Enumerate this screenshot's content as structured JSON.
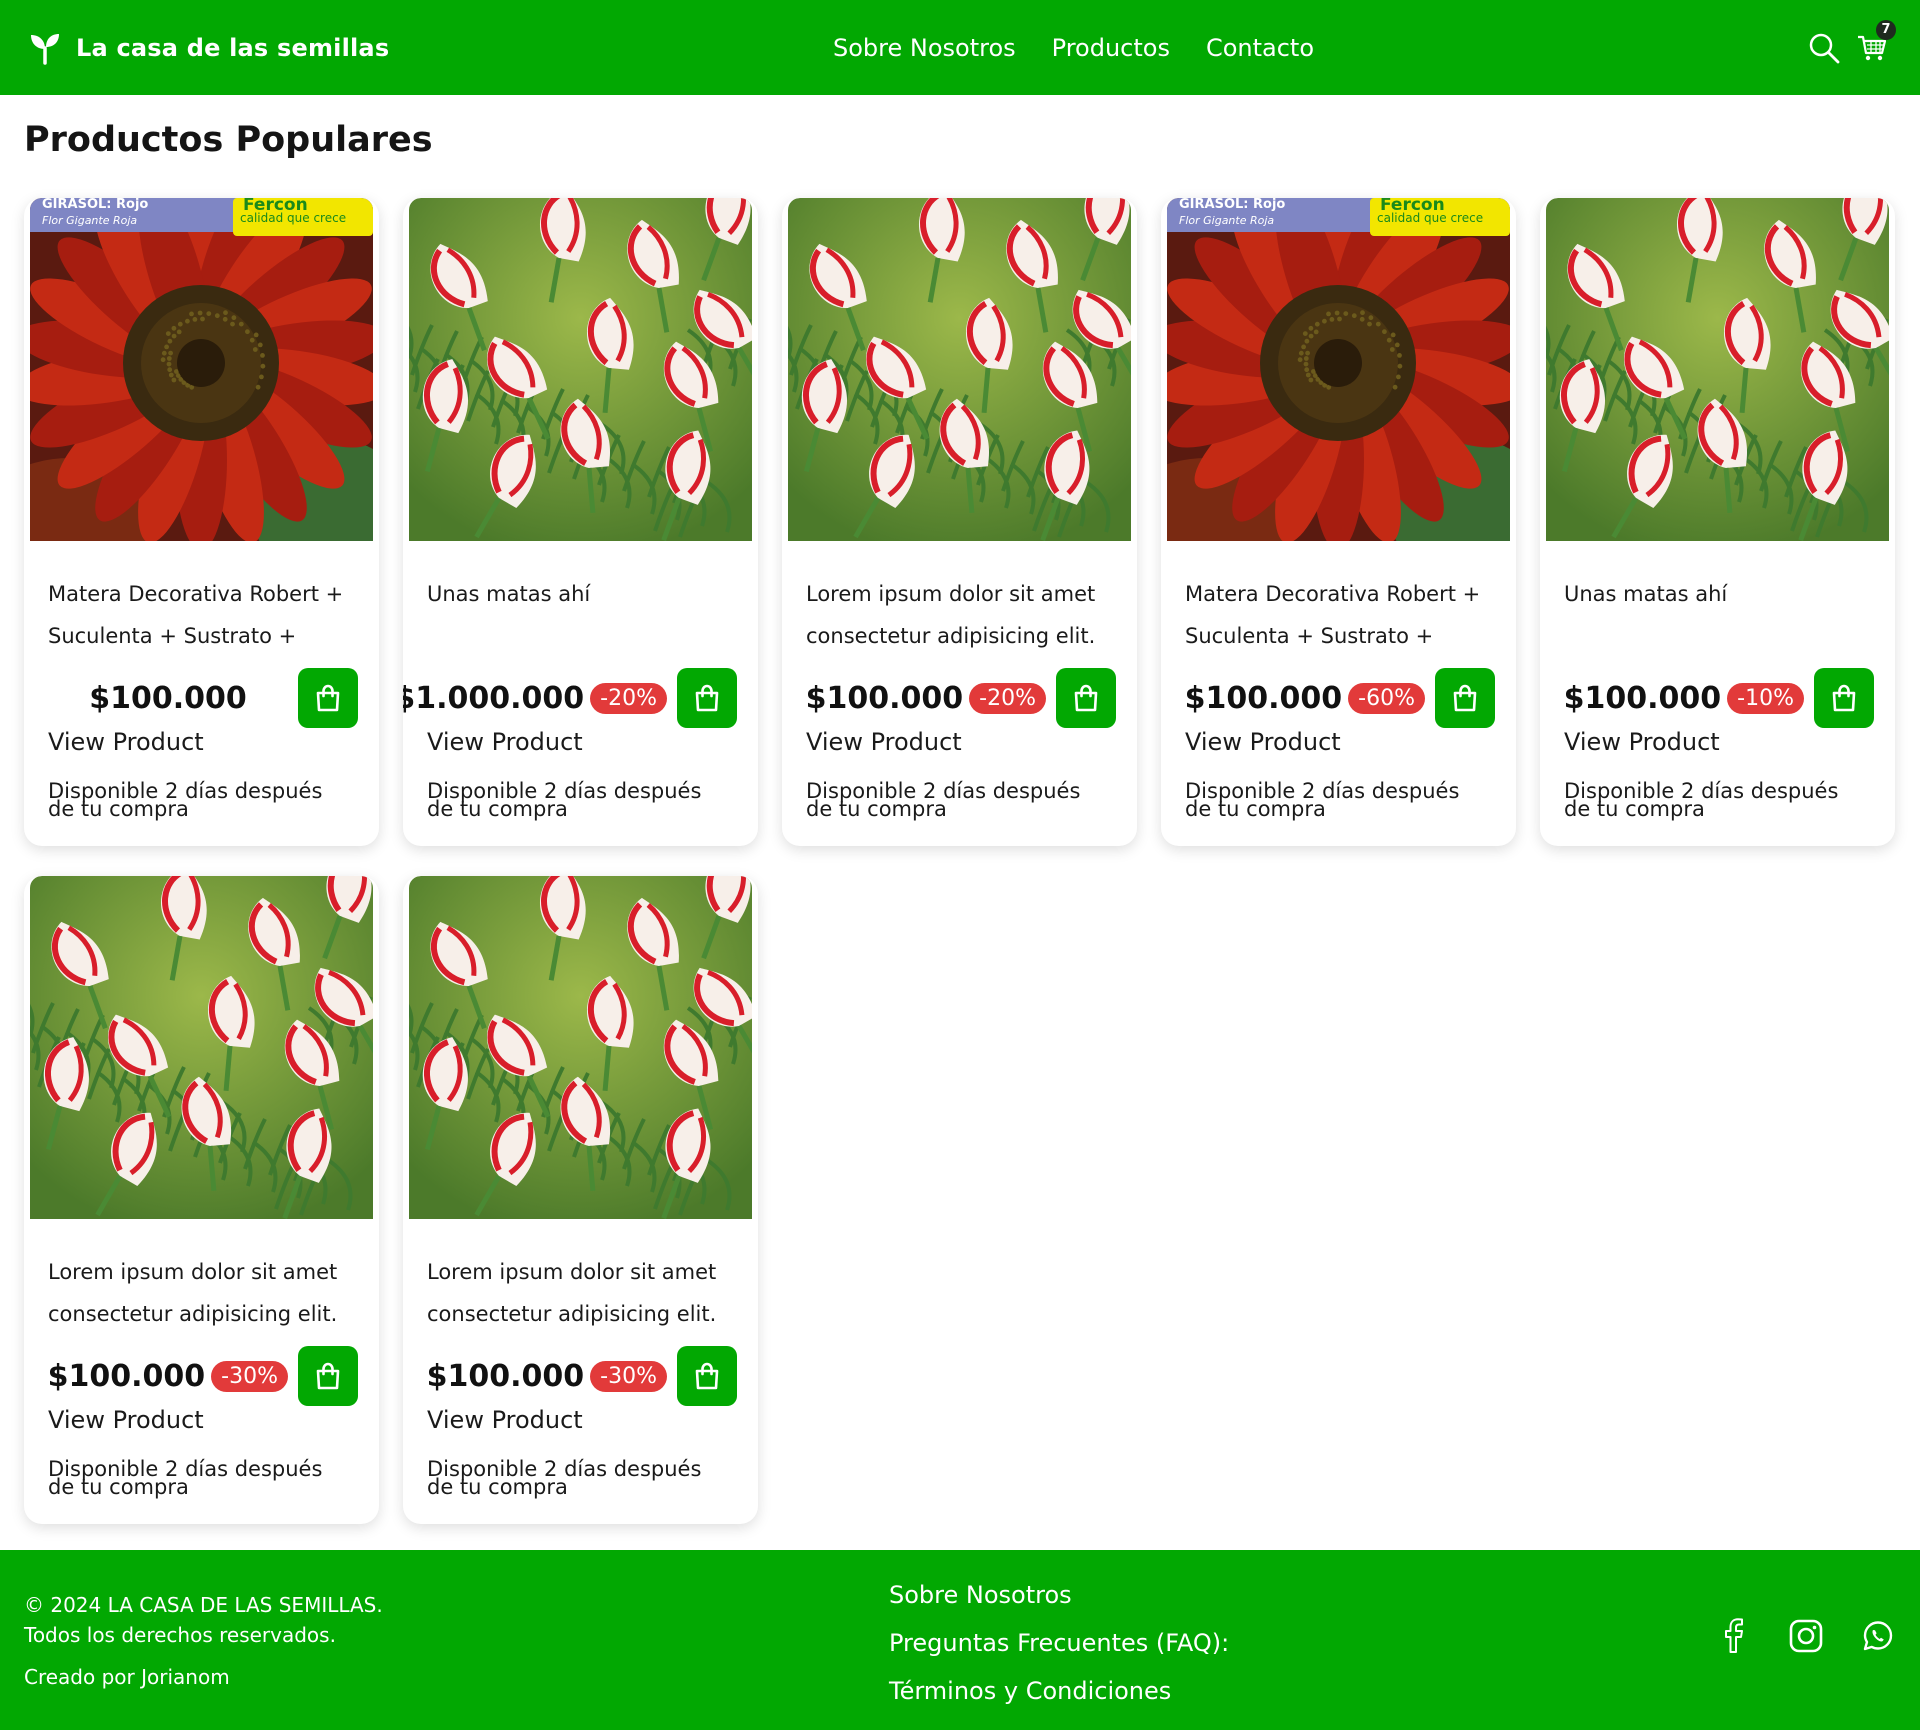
{
  "header": {
    "brand": "La casa de las semillas",
    "nav": [
      "Sobre Nosotros",
      "Productos",
      "Contacto"
    ],
    "cart_count": "7"
  },
  "section_title": "Productos Populares",
  "products": [
    {
      "name": "Matera Decorativa Robert + Suculenta + Sustrato +",
      "price": "$100.000",
      "discount": "",
      "view": "View Product",
      "availability": "Disponible 2 días después de tu compra",
      "image": "sunflower",
      "package_title": "GIRASOL: Rojo",
      "package_subtitle": "Flor Gigante Roja",
      "package_brand": "Fercon",
      "package_slogan": "calidad que crece"
    },
    {
      "name": "Unas matas ahí",
      "price": "$1.000.000",
      "discount": "-20%",
      "view": "View Product",
      "availability": "Disponible 2 días después de tu compra",
      "image": "striped-flowers"
    },
    {
      "name": "Lorem ipsum dolor sit amet consectetur adipisicing elit.",
      "price": "$100.000",
      "discount": "-20%",
      "view": "View Product",
      "availability": "Disponible 2 días después de tu compra",
      "image": "striped-flowers"
    },
    {
      "name": "Matera Decorativa Robert + Suculenta + Sustrato +",
      "price": "$100.000",
      "discount": "-60%",
      "view": "View Product",
      "availability": "Disponible 2 días después de tu compra",
      "image": "sunflower",
      "package_title": "GIRASOL: Rojo",
      "package_subtitle": "Flor Gigante Roja",
      "package_brand": "Fercon",
      "package_slogan": "calidad que crece"
    },
    {
      "name": "Unas matas ahí",
      "price": "$100.000",
      "discount": "-10%",
      "view": "View Product",
      "availability": "Disponible 2 días después de tu compra",
      "image": "striped-flowers"
    },
    {
      "name": "Lorem ipsum dolor sit amet consectetur adipisicing elit.",
      "price": "$100.000",
      "discount": "-30%",
      "view": "View Product",
      "availability": "Disponible 2 días después de tu compra",
      "image": "striped-flowers"
    },
    {
      "name": "Lorem ipsum dolor sit amet consectetur adipisicing elit.",
      "price": "$100.000",
      "discount": "-30%",
      "view": "View Product",
      "availability": "Disponible 2 días después de tu compra",
      "image": "striped-flowers"
    }
  ],
  "footer": {
    "copyright": "© 2024 LA CASA DE LAS SEMILLAS.",
    "rights": "Todos los derechos reservados.",
    "made_by": "Creado por Jorianom",
    "links": [
      "Sobre Nosotros",
      "Preguntas Frecuentes (FAQ):",
      "Términos y Condiciones"
    ],
    "social": [
      "facebook-icon",
      "instagram-icon",
      "whatsapp-icon"
    ]
  },
  "colors": {
    "primary": "#02a802",
    "discount": "#e23a3a",
    "text": "#1a1a1a"
  }
}
